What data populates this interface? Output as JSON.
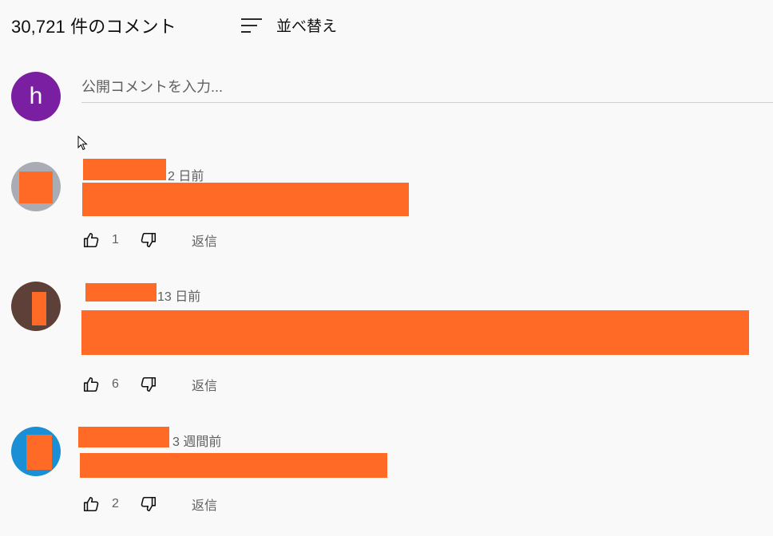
{
  "header": {
    "comment_count": "30,721 件のコメント",
    "sort_label": "並べ替え"
  },
  "composer": {
    "avatar_letter": "h",
    "placeholder": "公開コメントを入力..."
  },
  "comments": [
    {
      "time": "2 日前",
      "likes": "1",
      "reply_label": "返信"
    },
    {
      "time": "13 日前",
      "likes": "6",
      "reply_label": "返信"
    },
    {
      "time": "3 週間前",
      "likes": "2",
      "reply_label": "返信"
    }
  ],
  "colors": {
    "redaction": "#ff6a26",
    "self_avatar": "#7b1fa2",
    "avatar_2": "#5d4037",
    "avatar_3": "#1a8fd6"
  },
  "icons": {
    "sort": "sort-icon",
    "like": "thumbs-up-icon",
    "dislike": "thumbs-down-icon",
    "cursor": "mouse-pointer-icon"
  }
}
